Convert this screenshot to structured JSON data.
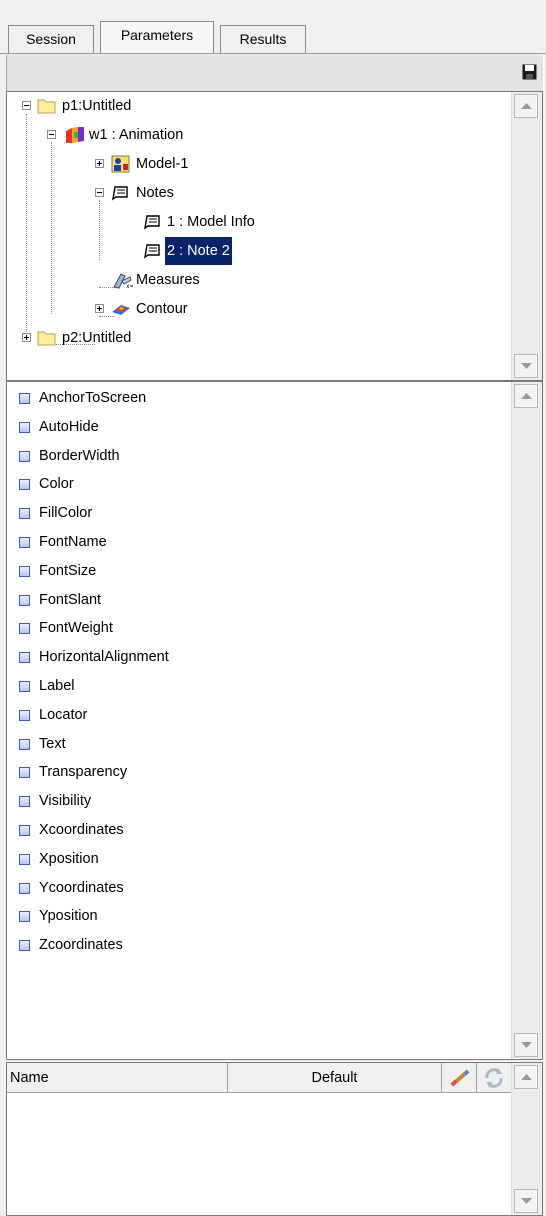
{
  "tabs": [
    {
      "label": "Session",
      "active": false
    },
    {
      "label": "Parameters",
      "active": true
    },
    {
      "label": "Results",
      "active": false
    }
  ],
  "tree": {
    "nodes": [
      {
        "label": "p1:Untitled",
        "icon": "folder-icon",
        "expander": "collapse"
      },
      {
        "label": "w1 : Animation",
        "icon": "animation-window-icon",
        "expander": "collapse"
      },
      {
        "label": "Model-1",
        "icon": "model-icon",
        "expander": "expand"
      },
      {
        "label": "Notes",
        "icon": "note-icon",
        "expander": "collapse"
      },
      {
        "label": "1 : Model Info",
        "icon": "note-icon",
        "expander": "none"
      },
      {
        "label": "2 : Note 2",
        "icon": "note-icon",
        "expander": "none",
        "selected": true
      },
      {
        "label": "Measures",
        "icon": "measures-icon",
        "expander": "none"
      },
      {
        "label": "Contour",
        "icon": "contour-icon",
        "expander": "expand"
      },
      {
        "label": "p2:Untitled",
        "icon": "folder-icon",
        "expander": "expand"
      }
    ]
  },
  "properties": [
    "AnchorToScreen",
    "AutoHide",
    "BorderWidth",
    "Color",
    "FillColor",
    "FontName",
    "FontSize",
    "FontSlant",
    "FontWeight",
    "HorizontalAlignment",
    "Label",
    "Locator",
    "Text",
    "Transparency",
    "Visibility",
    "Xcoordinates",
    "Xposition",
    "Ycoordinates",
    "Yposition",
    "Zcoordinates"
  ],
  "table": {
    "columns": [
      "Name",
      "Default"
    ]
  },
  "colors": {
    "selection": "#0a246a",
    "background": "#f0f0f0"
  }
}
